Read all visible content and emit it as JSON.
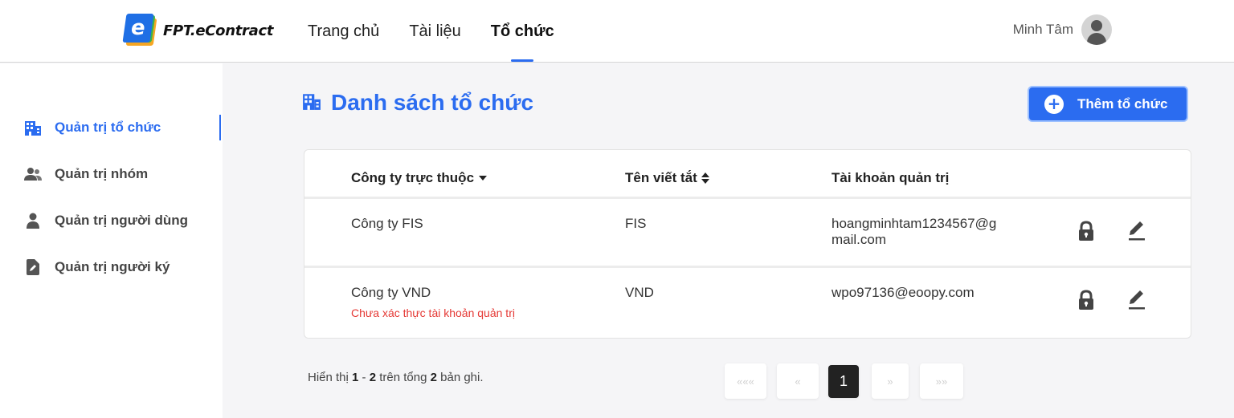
{
  "app": {
    "logo_letter": "e",
    "logo_text": "FPT.eContract"
  },
  "nav": [
    {
      "label": "Trang chủ",
      "active": false
    },
    {
      "label": "Tài liệu",
      "active": false
    },
    {
      "label": "Tổ chức",
      "active": true
    }
  ],
  "user": {
    "name": "Minh Tâm"
  },
  "sidebar": {
    "items": [
      {
        "label": "Quản trị tổ chức",
        "icon": "building-icon",
        "active": true
      },
      {
        "label": "Quản trị nhóm",
        "icon": "users-icon",
        "active": false
      },
      {
        "label": "Quản trị người dùng",
        "icon": "user-icon",
        "active": false
      },
      {
        "label": "Quản trị người ký",
        "icon": "signature-file-icon",
        "active": false
      }
    ]
  },
  "page": {
    "title": "Danh sách tổ chức",
    "add_button": "Thêm tổ chức"
  },
  "table": {
    "columns": [
      "Công ty trực thuộc",
      "Tên viết tắt",
      "Tài khoản quản trị"
    ],
    "rows": [
      {
        "company": "Công ty FIS",
        "short": "FIS",
        "account_line1": "hoangminhtam1234567@g",
        "account_line2": "mail.com",
        "warning": ""
      },
      {
        "company": "Công ty VND",
        "short": "VND",
        "account_line1": "wpo97136@eoopy.com",
        "account_line2": "",
        "warning": "Chưa xác thực tài khoản quản trị"
      }
    ]
  },
  "footer": {
    "prefix": "Hiển thị",
    "from": "1",
    "dash": "-",
    "to": "2",
    "middle": "trên tổng",
    "total": "2",
    "suffix": "bản ghi."
  },
  "pagination": {
    "first": "«««",
    "prev": "«",
    "current": "1",
    "next": "»",
    "last": "»»"
  },
  "colors": {
    "accent": "#2b6cf0",
    "warning": "#e53935"
  }
}
